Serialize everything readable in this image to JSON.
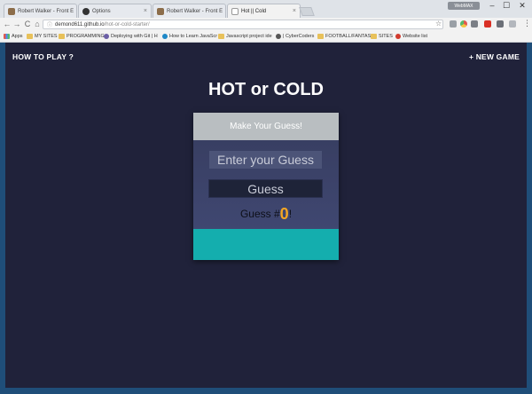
{
  "browser": {
    "tabs": [
      {
        "label": "Robert Walker - Front E",
        "favicon_color": "#8c6d4a"
      },
      {
        "label": "Options",
        "favicon_color": "#333333"
      },
      {
        "label": "Robert Walker - Front E",
        "favicon_color": "#8c6d4a"
      },
      {
        "label": "Hot || Cold",
        "favicon_color": "#ffffff"
      }
    ],
    "tab_close": "×",
    "user_badge": "WebMAX",
    "window_controls": {
      "minimize": "–",
      "maximize": "☐",
      "close": "✕"
    },
    "nav": {
      "back": "←",
      "forward": "→",
      "reload": "C",
      "home": "⌂"
    },
    "address": {
      "host": "demond611.github.io",
      "path": "/hot-or-cold-starter/",
      "lock": "ⓘ"
    },
    "star": "☆",
    "menu": "⋮",
    "bookmarks": [
      {
        "label": "Apps",
        "icon": "apps"
      },
      {
        "label": "MY SITES",
        "icon": "folder"
      },
      {
        "label": "PROGRAMMING",
        "icon": "folder"
      },
      {
        "label": "Deploying with Git | H",
        "icon": "round",
        "color": "#6b5fa6"
      },
      {
        "label": "How to Learn JavaScr",
        "icon": "round",
        "color": "#1e88c7"
      },
      {
        "label": "Javascript project ide",
        "icon": "folder"
      },
      {
        "label": "| CyberCoders",
        "icon": "round",
        "color": "#555555"
      },
      {
        "label": "FOOTBALL/FANTASY",
        "icon": "folder"
      },
      {
        "label": "SITES",
        "icon": "folder"
      },
      {
        "label": "Website list",
        "icon": "round",
        "color": "#d13b2e"
      }
    ]
  },
  "nav": {
    "how_to_play": "HOW TO PLAY ?",
    "new_game": "+ NEW GAME"
  },
  "title": "HOT or COLD",
  "game": {
    "header": "Make Your Guess!",
    "input_placeholder": "Enter your Guess",
    "button_label": "Guess",
    "count_prefix": "Guess #",
    "count_value": "0",
    "count_suffix": "!",
    "feedback_color": "#14aeae"
  },
  "colors": {
    "background": "#20223a",
    "card_header": "#b9bec1",
    "accent": "#f5a623"
  }
}
